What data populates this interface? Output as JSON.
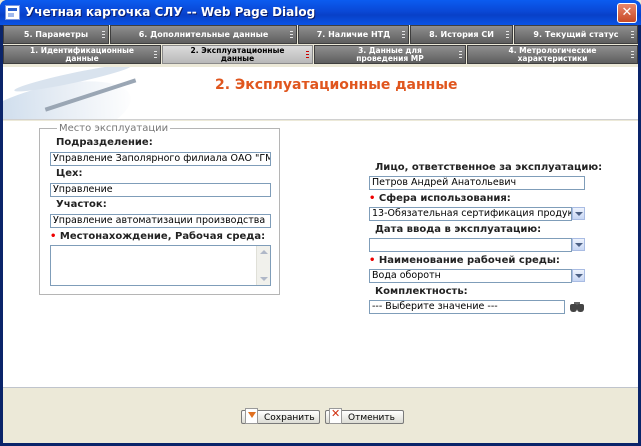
{
  "window": {
    "title": "Учетная карточка СЛУ -- Web Page Dialog",
    "close_glyph": "✕"
  },
  "tabs_top": [
    {
      "label": "5. Параметры"
    },
    {
      "label": "6. Дополнительные данные"
    },
    {
      "label": "7. Наличие НТД"
    },
    {
      "label": "8. История СИ"
    },
    {
      "label": "9. Текущий статус"
    }
  ],
  "tabs_bottom": [
    {
      "line1": "1. Идентификационные",
      "line2": "данные"
    },
    {
      "line1": "2. Эксплуатационные",
      "line2": "данные",
      "active": true
    },
    {
      "line1": "3. Данные для",
      "line2": "проведения МР"
    },
    {
      "line1": "4. Метрологические",
      "line2": "характеристики"
    }
  ],
  "heading": "2. Эксплуатационные данные",
  "required_mark": "•",
  "left": {
    "legend": "Место эксплуатации",
    "subdivision_label": "Подразделение:",
    "subdivision_value": "Управление Заполярного филиала ОАО \"ГМК",
    "shop_label": "Цех:",
    "shop_value": "Управление",
    "section_label": "Участок:",
    "section_value": "Управление автоматизации производства",
    "location_label": "Местонахождение, Рабочая среда:",
    "location_value": ""
  },
  "right": {
    "responsible_label": "Лицо, ответственное за эксплуатацию:",
    "responsible_value": "Петров Андрей Анатольевич",
    "usage_label": "Сфера использования:",
    "usage_value": "13-Обязательная сертификация продукци",
    "date_label": "Дата ввода в эксплуатацию:",
    "date_value": "",
    "env_label": "Наименование рабочей среды:",
    "env_value": "Вода оборотн",
    "kit_label": "Комплектность:",
    "kit_value": "--- Выберите значение ---"
  },
  "buttons": {
    "save": "Сохранить",
    "cancel": "Отменить"
  }
}
